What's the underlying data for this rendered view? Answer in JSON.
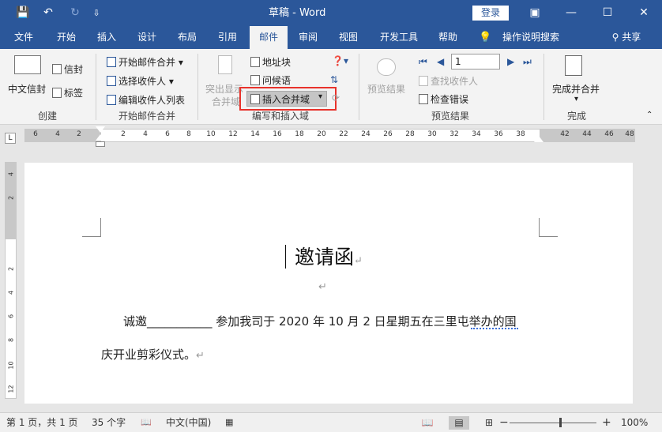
{
  "titlebar": {
    "title": "草稿  -  Word",
    "login": "登录",
    "save_icon": "💾",
    "undo_icon": "↶",
    "redo_icon": "↻",
    "customize_icon": "⇩",
    "restore_icon": "▣",
    "minimize_icon": "—",
    "maximize_icon": "☐",
    "close_icon": "✕"
  },
  "tabs": [
    "文件",
    "开始",
    "插入",
    "设计",
    "布局",
    "引用",
    "邮件",
    "审阅",
    "视图",
    "开发工具",
    "帮助"
  ],
  "active_tab": "邮件",
  "tellme": "操作说明搜索",
  "share": "共享",
  "ribbon": {
    "create": {
      "zh_envelope": "中文信封",
      "envelopes": "信封",
      "labels": "标签",
      "label": "创建"
    },
    "start": {
      "start_merge": "开始邮件合并",
      "select_recipients": "选择收件人",
      "edit_list": "编辑收件人列表",
      "label": "开始邮件合并"
    },
    "write": {
      "highlight_fields_1": "突出显示",
      "highlight_fields_2": "合并域",
      "address_block": "地址块",
      "greeting_line": "问候语",
      "insert_merge_field": "插入合并域",
      "label": "编写和插入域"
    },
    "preview": {
      "preview_results": "预览结果",
      "record": "1",
      "find_recipient": "查找收件人",
      "check_errors": "检查错误",
      "label": "预览结果"
    },
    "finish": {
      "finish_merge": "完成并合并",
      "label": "完成"
    }
  },
  "ruler": {
    "tab_selector": "L",
    "numbers": [
      "6",
      "4",
      "2",
      "",
      "2",
      "4",
      "6",
      "8",
      "10",
      "12",
      "14",
      "16",
      "18",
      "20",
      "22",
      "24",
      "26",
      "28",
      "30",
      "32",
      "34",
      "36",
      "38",
      "",
      "42",
      "44",
      "46",
      "48"
    ]
  },
  "vruler": [
    "4",
    "2",
    "",
    "2",
    "4",
    "6",
    "8",
    "10",
    "12"
  ],
  "document": {
    "title": "邀请函",
    "para1": "诚邀___________ 参加我司于 2020 年 10 月 2 日星期五在三里屯举办的国",
    "para2": "庆开业剪彩仪式。",
    "para_mark": "↵"
  },
  "statusbar": {
    "page": "第 1 页，共 1 页",
    "words": "35 个字",
    "language": "中文(中国)",
    "zoom_minus": "−",
    "zoom_plus": "+",
    "zoom": "100%"
  }
}
